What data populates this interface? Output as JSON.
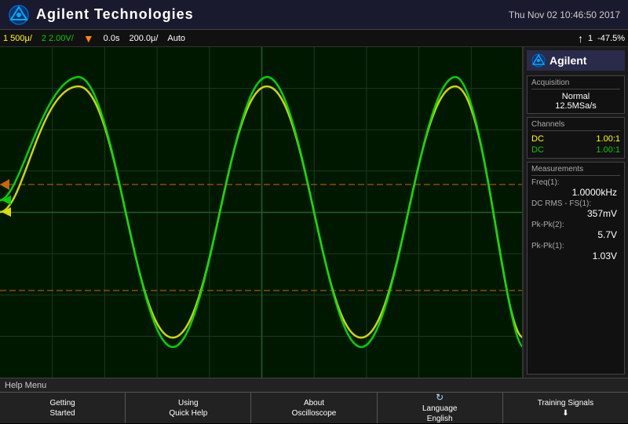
{
  "header": {
    "title": "Agilent Technologies",
    "timestamp": "Thu Nov 02 10:46:50 2017"
  },
  "toolbar": {
    "ch1_label": "1",
    "ch1_value": "500μ/",
    "ch2_label": "2",
    "ch2_value": "2.00V/",
    "time_value": "0.0s",
    "time_div": "200.0μ/",
    "trigger_mode": "Auto",
    "arrow_up": "▲",
    "ch_position": "-47.5%"
  },
  "side_panel": {
    "brand": "Agilent",
    "acquisition": {
      "title": "Acquisition",
      "mode": "Normal",
      "rate": "12.5MSa/s"
    },
    "channels": {
      "title": "Channels",
      "ch1_coupling": "DC",
      "ch1_probe": "1.00:1",
      "ch2_coupling": "DC",
      "ch2_probe": "1.00:1"
    },
    "measurements": {
      "title": "Measurements",
      "freq_label": "Freq(1):",
      "freq_value": "1.0000kHz",
      "dc_rms_label": "DC RMS - FS(1):",
      "dc_rms_value": "357mV",
      "pk_pk2_label": "Pk-Pk(2):",
      "pk_pk2_value": "5.7V",
      "pk_pk1_label": "Pk-Pk(1):",
      "pk_pk1_value": "1.03V"
    }
  },
  "footer": {
    "help_menu_label": "Help Menu",
    "buttons": [
      {
        "line1": "Getting",
        "line2": "Started"
      },
      {
        "line1": "Using",
        "line2": "Quick Help"
      },
      {
        "line1": "About",
        "line2": "Oscilloscope"
      },
      {
        "line1": "Language",
        "line2": "English",
        "has_icon": true
      },
      {
        "line1": "Training Signals",
        "line2": "⬇",
        "has_icon": false
      }
    ]
  }
}
